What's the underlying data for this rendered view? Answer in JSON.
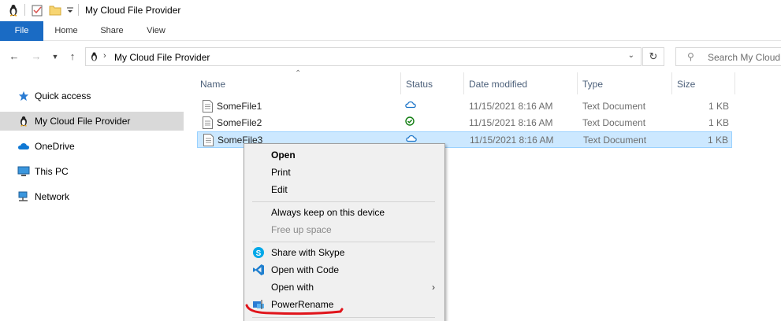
{
  "window": {
    "title": "My Cloud File Provider"
  },
  "ribbon": {
    "tabs": [
      "File",
      "Home",
      "Share",
      "View"
    ]
  },
  "address": {
    "path": "My Cloud File Provider",
    "search_placeholder": "Search My Cloud"
  },
  "navpane": {
    "items": [
      {
        "label": "Quick access",
        "icon": "star-icon"
      },
      {
        "label": "My Cloud File Provider",
        "icon": "cloud-provider-icon",
        "selected": true
      },
      {
        "label": "OneDrive",
        "icon": "onedrive-icon"
      },
      {
        "label": "This PC",
        "icon": "computer-icon"
      },
      {
        "label": "Network",
        "icon": "network-icon"
      }
    ]
  },
  "filelist": {
    "columns": {
      "name": "Name",
      "status": "Status",
      "date": "Date modified",
      "type": "Type",
      "size": "Size"
    },
    "rows": [
      {
        "name": "SomeFile1",
        "status": "cloud",
        "date": "11/15/2021 8:16 AM",
        "type": "Text Document",
        "size": "1 KB"
      },
      {
        "name": "SomeFile2",
        "status": "synced",
        "date": "11/15/2021 8:16 AM",
        "type": "Text Document",
        "size": "1 KB"
      },
      {
        "name": "SomeFile3",
        "status": "cloud",
        "date": "11/15/2021 8:16 AM",
        "type": "Text Document",
        "size": "1 KB",
        "selected": true
      }
    ]
  },
  "context_menu": {
    "open": "Open",
    "print": "Print",
    "edit": "Edit",
    "always_keep": "Always keep on this device",
    "free_up": "Free up space",
    "share_skype": "Share with Skype",
    "open_code": "Open with Code",
    "open_with": "Open with",
    "powerrename": "PowerRename"
  },
  "colors": {
    "file_tab": "#1a6bc4",
    "selection": "#cce8ff",
    "annotation": "#e0141b"
  }
}
